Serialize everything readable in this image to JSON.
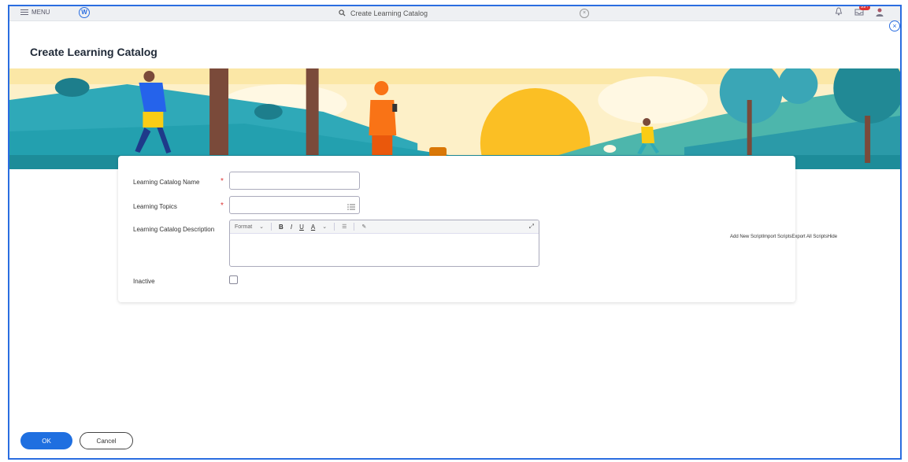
{
  "topbar": {
    "menu_label": "MENU",
    "search_text": "Create Learning Catalog",
    "notification_badge": "99+"
  },
  "page": {
    "title": "Create Learning Catalog"
  },
  "form": {
    "name_label": "Learning Catalog Name",
    "topics_label": "Learning Topics",
    "description_label": "Learning Catalog Description",
    "inactive_label": "Inactive",
    "toolbar": {
      "format": "Format",
      "bold": "B",
      "italic": "I",
      "underline": "U",
      "color": "A"
    }
  },
  "scripts_text": "Add New ScriptImport ScriptsExport All ScriptsHide",
  "buttons": {
    "ok": "OK",
    "cancel": "Cancel"
  },
  "colors": {
    "accent": "#1f6fe0",
    "required": "#d33333"
  }
}
